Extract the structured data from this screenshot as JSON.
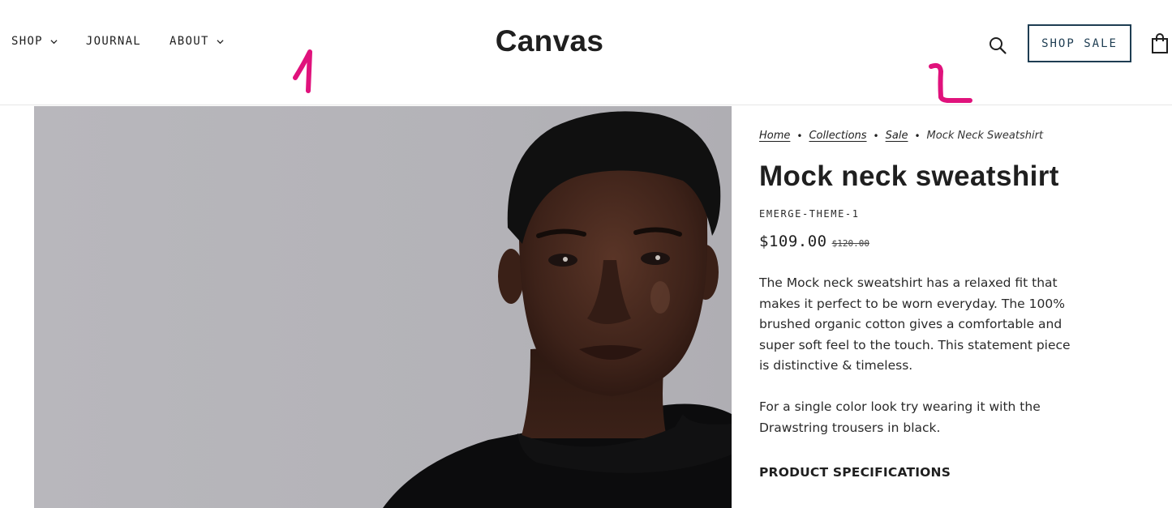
{
  "header": {
    "nav": [
      {
        "label": "SHOP",
        "has_dropdown": true
      },
      {
        "label": "JOURNAL",
        "has_dropdown": false
      },
      {
        "label": "ABOUT",
        "has_dropdown": true
      }
    ],
    "logo": "Canvas",
    "search_icon": "search-icon",
    "sale_button": "SHOP SALE",
    "cart_icon": "shopping-bag-icon"
  },
  "annotations": [
    "1",
    "2"
  ],
  "product": {
    "breadcrumb": {
      "links": [
        "Home",
        "Collections",
        "Sale"
      ],
      "current": "Mock Neck Sweatshirt"
    },
    "title": "Mock neck sweatshirt",
    "sku": "EMERGE-THEME-1",
    "price": "$109.00",
    "compare_price": "$120.00",
    "description": [
      "The Mock neck sweatshirt has a relaxed fit that makes it perfect to be worn everyday. The 100% brushed organic cotton gives a comfortable and super soft feel to the touch. This statement piece is distinctive & timeless.",
      "For a single color look try wearing it with the Drawstring trousers in black."
    ],
    "spec_heading": "PRODUCT SPECIFICATIONS"
  },
  "colors": {
    "accent": "#1e3d52",
    "annotation": "#e0127c",
    "text": "#1f1f1f",
    "photo_bg": "#b6b5ba"
  }
}
